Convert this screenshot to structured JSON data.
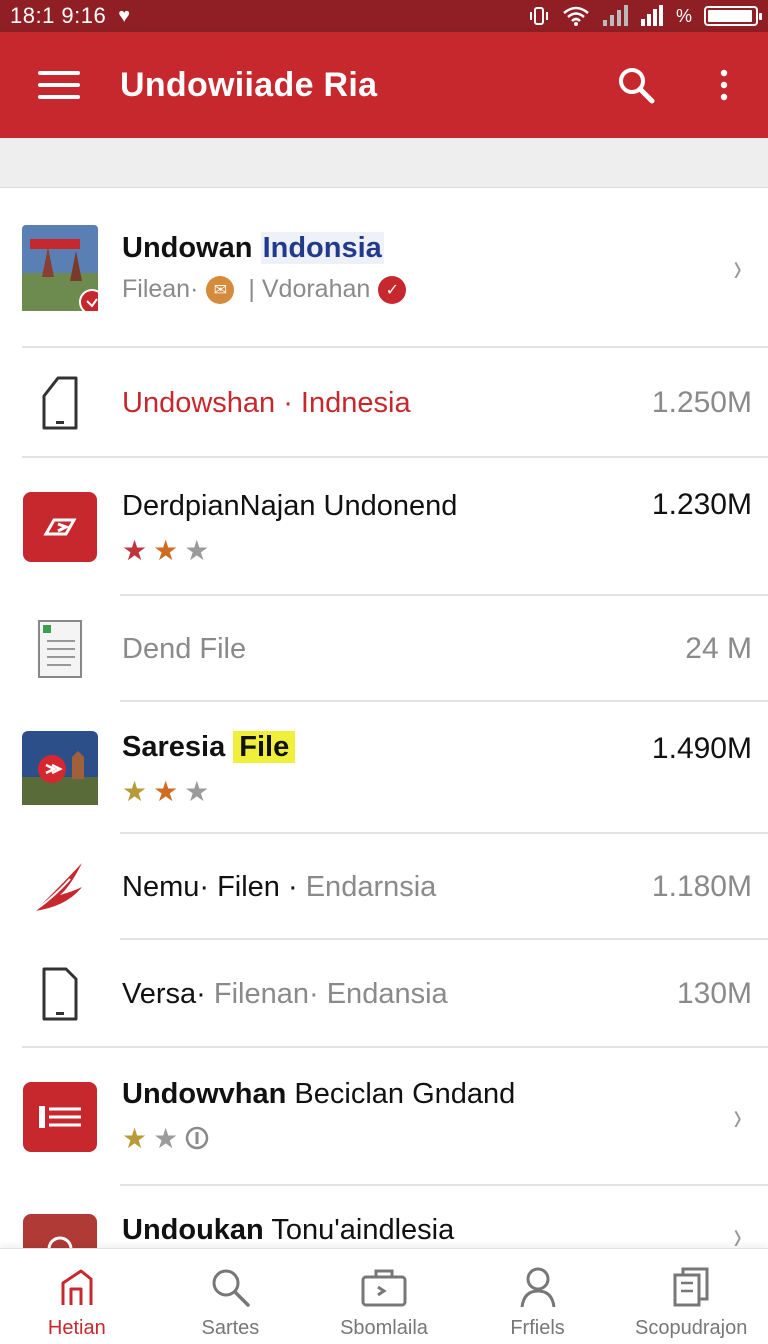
{
  "status_bar": {
    "time": "18:1 9:16",
    "signal_text": "%"
  },
  "app_bar": {
    "title": "Undowiiade Ria"
  },
  "colors": {
    "primary": "#c7282e",
    "status_bar": "#8f1f24"
  },
  "list": [
    {
      "title_bold": "Undowan",
      "title_highlight": "Indonsia",
      "sub_left": "Filean·",
      "sub_right": "| Vdorahan",
      "icon": "landmark-photo",
      "trailing": "chevron-right"
    },
    {
      "title": "Undowshan · Indnesia",
      "size": "1.250M",
      "icon": "phone-outline-icon"
    },
    {
      "title": "DerdpianNajan Undonend",
      "size": "1.230M",
      "rating": 2,
      "icon": "app-play-icon"
    },
    {
      "title": "Dend File",
      "size": "24 M",
      "icon": "document-icon"
    },
    {
      "title_bold": "Saresia",
      "title_highlight": "File",
      "size": "1.490M",
      "rating": 2,
      "icon": "castle-photo"
    },
    {
      "title_main": "Nemu· Filen ·",
      "title_muted": "Endarnsia",
      "size": "1.180M",
      "icon": "feather-icon"
    },
    {
      "title_main": "Versa·",
      "title_muted": "Filenan· Endansia",
      "size": "130M",
      "icon": "phone-outline-icon"
    },
    {
      "title_bold": "Undowvhan",
      "title_rest": "Beciclan Gndand",
      "rating": 2,
      "icon": "app-list-icon",
      "trailing": "chevron-right"
    },
    {
      "title_bold": "Undoukan",
      "title_rest": "Tonu'aindlesia",
      "icon": "app-tile",
      "trailing": "chevron-right"
    }
  ],
  "bottom_nav": [
    {
      "label": "Hetian",
      "icon": "home-icon",
      "active": true
    },
    {
      "label": "Sartes",
      "icon": "search-icon",
      "active": false
    },
    {
      "label": "Sbomlaila",
      "icon": "briefcase-icon",
      "active": false
    },
    {
      "label": "Frfiels",
      "icon": "profile-icon",
      "active": false
    },
    {
      "label": "Scopudrajon",
      "icon": "files-icon",
      "active": false
    }
  ]
}
